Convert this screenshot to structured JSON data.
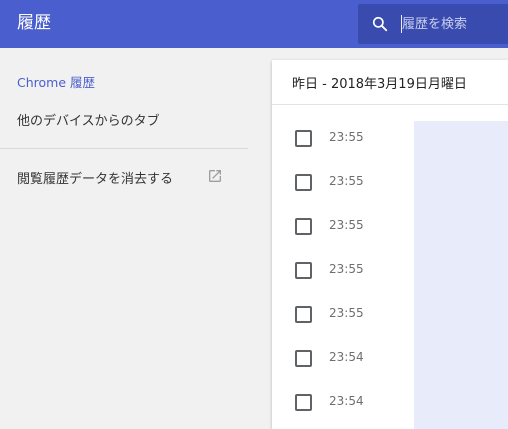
{
  "app": {
    "title": "履歴"
  },
  "search": {
    "placeholder": "履歴を検索",
    "icon": "search-icon"
  },
  "sidebar": {
    "items": [
      {
        "label": "Chrome 履歴",
        "active": true
      },
      {
        "label": "他のデバイスからのタブ",
        "active": false
      },
      {
        "label": "閲覧履歴データを消去する",
        "active": false,
        "icon": "open-in-new-icon"
      }
    ]
  },
  "main": {
    "day_title": "昨日 - 2018年3月19日月曜日",
    "entries": [
      {
        "time": "23:55"
      },
      {
        "time": "23:55"
      },
      {
        "time": "23:55"
      },
      {
        "time": "23:55"
      },
      {
        "time": "23:55"
      },
      {
        "time": "23:54"
      },
      {
        "time": "23:54"
      }
    ]
  },
  "colors": {
    "header": "#4a5fcd",
    "search_box": "#3a4bb0",
    "accent": "#4a5fcd",
    "background": "#f1f1f1",
    "card": "#ffffff"
  }
}
